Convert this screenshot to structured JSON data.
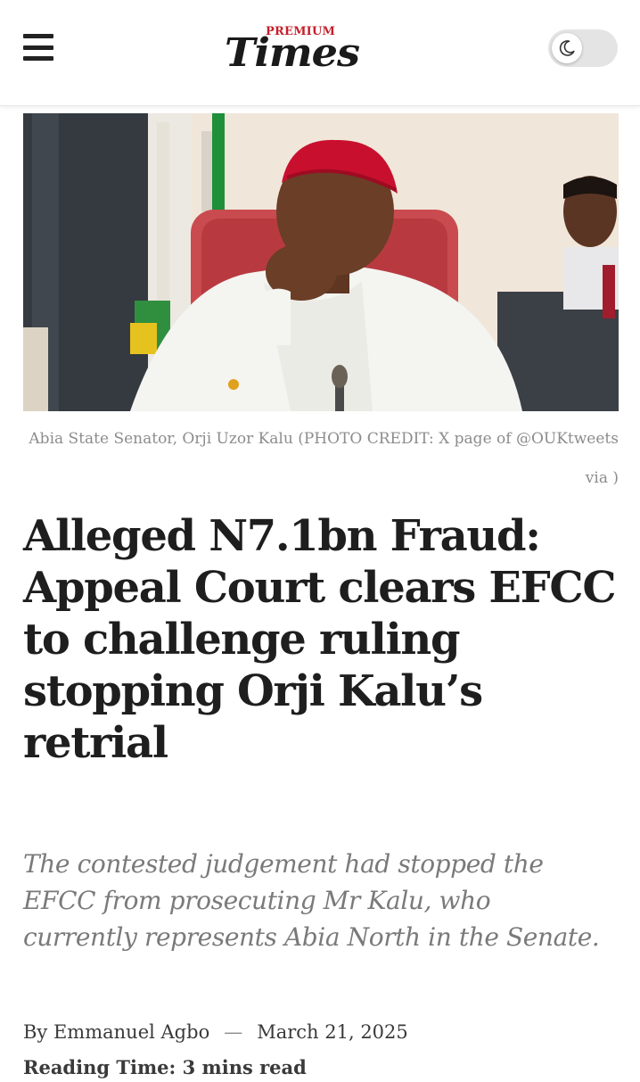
{
  "header": {
    "logo_premium": "PREMIUM",
    "logo_times": "Times",
    "menu_icon": "hamburger-menu-icon",
    "theme_icon": "moon-icon",
    "accent_color": "#c41e2a"
  },
  "article": {
    "image_caption": "Abia State Senator, Orji Uzor Kalu (PHOTO CREDIT: X page of @OUKtweets via )",
    "headline": "Alleged N7.1bn Fraud: Appeal Court clears EFCC to challenge ruling stopping Orji Kalu’s retrial",
    "subtitle": "The contested judgement had stopped the EFCC from prosecuting Mr Kalu, who currently represents Abia North in the Senate.",
    "byline": "By Emmanuel Agbo",
    "separator": "—",
    "date": "March 21, 2025",
    "reading_time": "Reading Time: 3 mins read"
  }
}
